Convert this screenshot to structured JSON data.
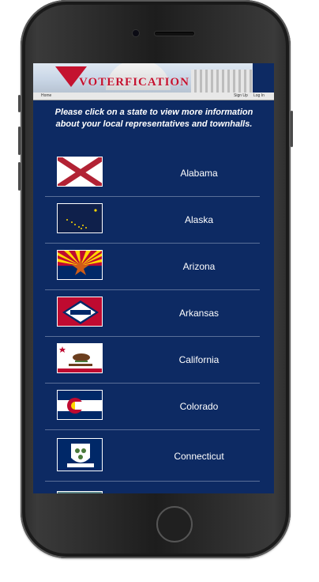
{
  "site": {
    "logo_text": "VOTERFICATION",
    "nav": {
      "home": "Home",
      "signup": "Sign Up",
      "login": "Log In"
    }
  },
  "intro": "Please click on a state to view more information about your local representatives and townhalls.",
  "states": [
    {
      "name": "Alabama"
    },
    {
      "name": "Alaska"
    },
    {
      "name": "Arizona"
    },
    {
      "name": "Arkansas"
    },
    {
      "name": "California"
    },
    {
      "name": "Colorado"
    },
    {
      "name": "Connecticut"
    }
  ],
  "colors": {
    "background": "#0d2a63",
    "accent_red": "#c4122f"
  }
}
